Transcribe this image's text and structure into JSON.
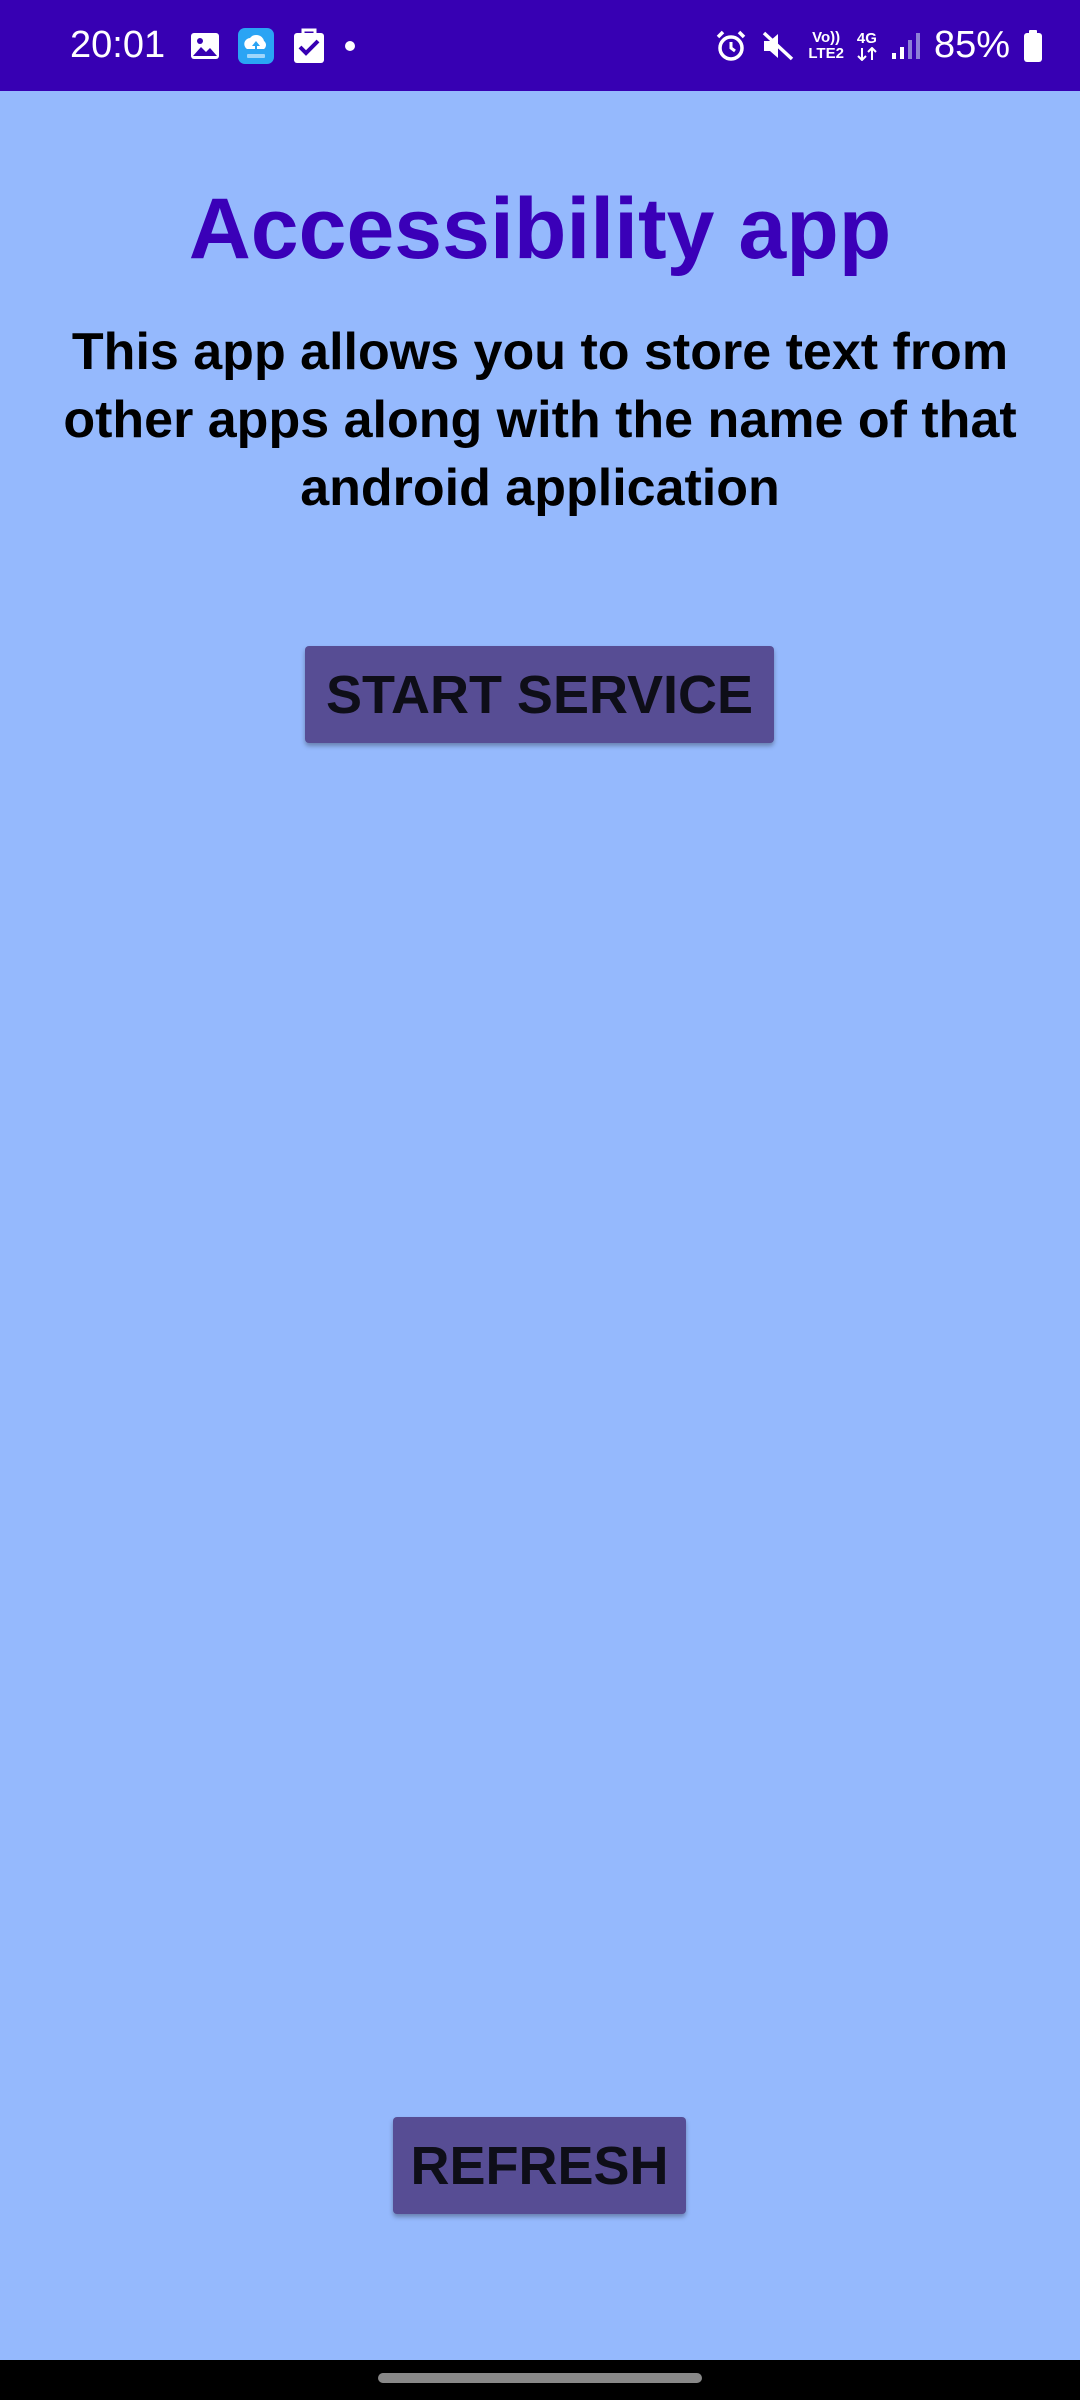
{
  "status_bar": {
    "time": "20:01",
    "battery": "85%",
    "network_top": "Vo))",
    "network_bottom": "LTE2",
    "data_type": "4G",
    "icons": [
      "gallery-icon",
      "cloud-upload-icon",
      "shopping-bag-icon",
      "dot-icon",
      "alarm-icon",
      "mute-icon",
      "signal-icon",
      "battery-icon"
    ]
  },
  "app": {
    "title": "Accessibility app",
    "description": "This app allows you to store text from other apps along with the name of that android application",
    "start_button": "START SERVICE",
    "refresh_button": "REFRESH"
  },
  "colors": {
    "status_bar": "#3700b3",
    "background": "#95b9fd",
    "title": "#3a00b8",
    "button": "#574d94"
  }
}
